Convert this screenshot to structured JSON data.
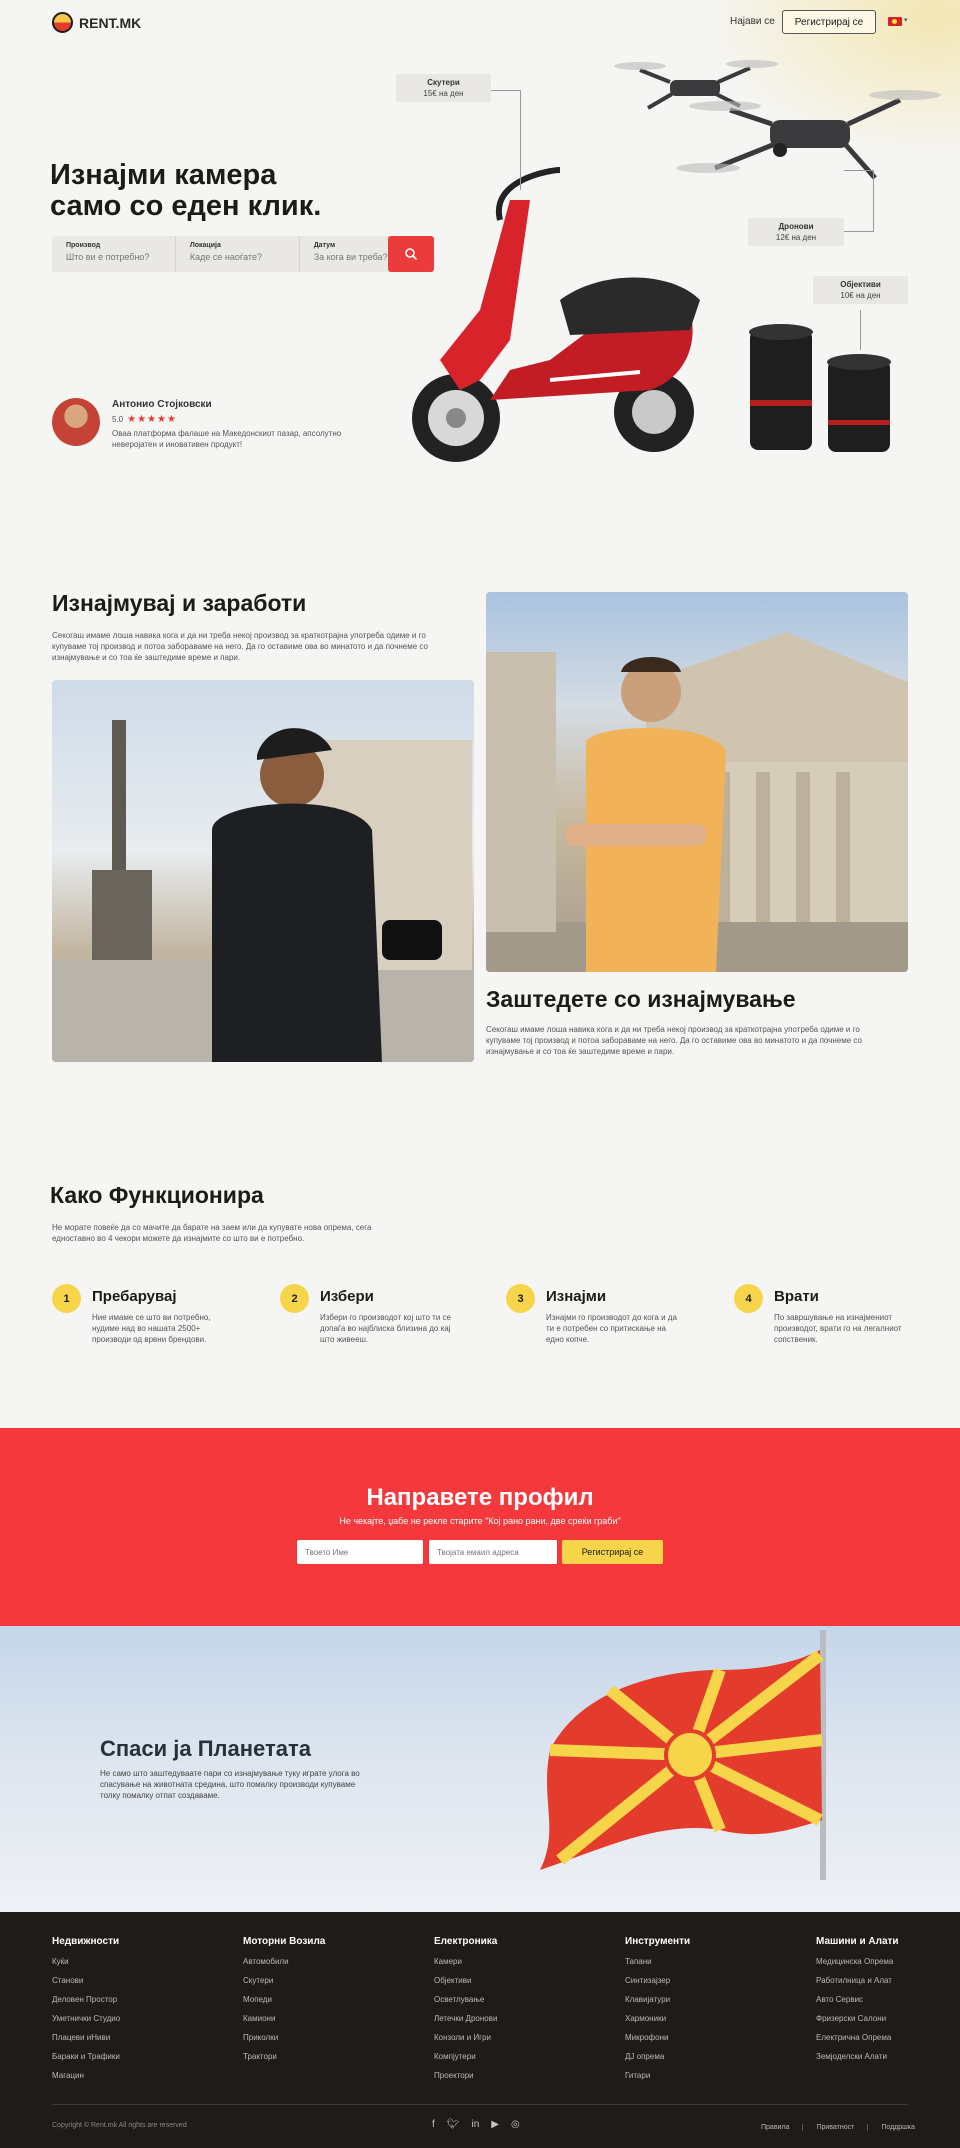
{
  "header": {
    "logo": "RENT.MK",
    "login": "Најави се",
    "register": "Регистрирај се"
  },
  "hero": {
    "title_line1": "Изнајми камера",
    "title_line2": "само со еден клик.",
    "search": {
      "product_label": "Производ",
      "product_placeholder": "Што ви е потребно?",
      "location_label": "Локација",
      "location_placeholder": "Каде се наоѓате?",
      "date_label": "Датум",
      "date_placeholder": "За кога ви треба?"
    },
    "review": {
      "name": "Антонио Стојковски",
      "score": "5.0",
      "stars": "★★★★★",
      "text": "Оваа платформа фалаше на Македонскиот пазар, апсолутно неверојатен и иновативен продукт!"
    },
    "tags": [
      {
        "name": "Скутери",
        "price": "15€ на ден"
      },
      {
        "name": "Дронови",
        "price": "12€ на ден"
      },
      {
        "name": "Објективи",
        "price": "10€ на ден"
      }
    ]
  },
  "earn": {
    "title": "Изнајмувај и заработи",
    "text": "Секогаш имаме лоша навика кога и да ни треба некој производ за краткотрајна употреба одиме и го купуваме тој производ и потоа забораваме на него. Да го оставиме ова во минатото и да почнеме со изнајмување и со тоа ќе заштедиме време и пари."
  },
  "save": {
    "title": "Заштедете со изнајмување",
    "text": "Секогаш имаме лоша навика кога и да ни треба некој производ за краткотрајна употреба одиме и го купуваме тој производ и потоа забораваме на него. Да го оставиме ова во минатото и да почнеме со изнајмување и со тоа ќе заштедиме време и пари."
  },
  "how": {
    "title": "Како Функционира",
    "text": "Не морате повеќе да со мачите да барате на заем или да купувате нова опрема, сега едноставно во 4 чекори можете да изнајмите со што ви е потребно.",
    "steps": [
      {
        "num": "1",
        "title": "Пребарувај",
        "text": "Ние имаме се што ви потребно, нудиме над во нашата 2500+ производи од врвни брендови."
      },
      {
        "num": "2",
        "title": "Избери",
        "text": "Избери го производот кој што ти се допаѓа во најблиска близина до кај што живееш."
      },
      {
        "num": "3",
        "title": "Изнајми",
        "text": "Изнајми го производот до кога и да ти е потребен со притискање на едно копче."
      },
      {
        "num": "4",
        "title": "Врати",
        "text": "По завршување на изнајмениот производот, врати го на легалниот сопственик."
      }
    ]
  },
  "signup": {
    "title": "Направете профил",
    "subtitle": "Не чекајте, џабе не рекле старите \"Кој рано рани, две среќи граби\"",
    "name_placeholder": "Твоето Име",
    "email_placeholder": "Твојата емаил адреса",
    "button": "Регистрирај се"
  },
  "planet": {
    "title": "Спаси ја Планетата",
    "text": "Не само што заштедуваате пари со изнајмување туку играте улога во спасување на животната средина, што помалку производи купуваме толку помалку отпат создаваме."
  },
  "footer": {
    "columns": [
      {
        "title": "Недвижности",
        "items": [
          "Куќи",
          "Станови",
          "Деловен Простор",
          "Уметнички Студио",
          "Плацеви иНиви",
          "Бараки и Трафики",
          "Магацин"
        ]
      },
      {
        "title": "Моторни Возила",
        "items": [
          "Автомобили",
          "Скутери",
          "Мопеди",
          "Камиони",
          "Приколки",
          "Трактори"
        ]
      },
      {
        "title": "Електроника",
        "items": [
          "Камери",
          "Објективи",
          "Осветлување",
          "Летечки Дронови",
          "Конзоли и Игри",
          "Компјутери",
          "Проектори"
        ]
      },
      {
        "title": "Инструменти",
        "items": [
          "Тапани",
          "Синтизајзер",
          "Клавијатури",
          "Хармоники",
          "Микрофони",
          "ДЈ опрема",
          "Гитари"
        ]
      },
      {
        "title": "Машини и Алати",
        "items": [
          "Медицинска Опрема",
          "Работилница и Алат",
          "Авто Сервис",
          "Фризерски Салони",
          "Електрична Опрема",
          "Земјоделски Алати"
        ]
      }
    ],
    "copyright": "Copyright © Rent.mk All rights are reserved",
    "links": [
      "Правила",
      "Приватност",
      "Поддршка"
    ]
  },
  "colors": {
    "accent": "#f4383c",
    "yellow": "#f7d54a",
    "dark": "#1f1b19"
  }
}
